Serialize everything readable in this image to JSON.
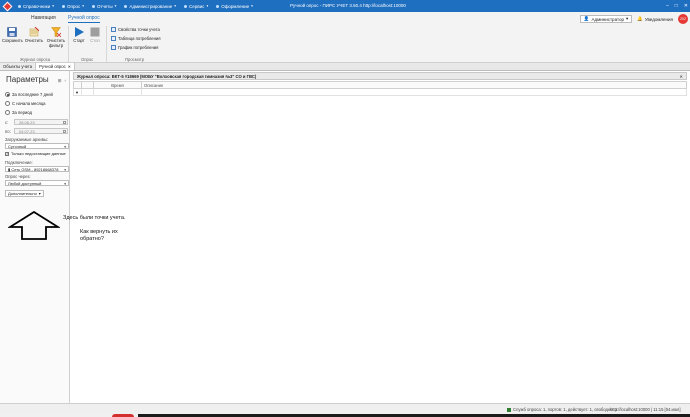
{
  "titlebar": {
    "menu": [
      {
        "label": "Справочники"
      },
      {
        "label": "Опрос"
      },
      {
        "label": "Отчеты"
      },
      {
        "label": "Администрирование"
      },
      {
        "label": "Сервис"
      },
      {
        "label": "Оформление"
      }
    ],
    "title": "Ручной опрос - ПИРС УЧЕТ 3.50.4 http://localhost:10000"
  },
  "ribbon": {
    "tabs": {
      "nav": "Навигация",
      "manual": "Ручной опрос"
    },
    "buttons": {
      "save": "Сохранить",
      "clear": "Очистить",
      "clear_filter_1": "Очистить",
      "clear_filter_2": "фильтр",
      "start": "Старт",
      "stop": "Стоп"
    },
    "links": {
      "properties": "Свойства точки учета",
      "table": "Таблица потребления",
      "chart": "График потребления"
    },
    "groups": {
      "journal": "Журнал опроса",
      "poll": "Опрос",
      "view": "Просмотр"
    }
  },
  "user": {
    "name": "Администратор",
    "notifications": "Уведомления",
    "avatar": "202"
  },
  "doc_tabs": [
    {
      "label": "Объекты учета"
    },
    {
      "label": "Ручной опрос"
    }
  ],
  "params": {
    "title": "Параметры",
    "period_options": [
      "За последние 7 дней",
      "С начала месяца",
      "За период"
    ],
    "from_label": "с:",
    "from_value": "28.06.23",
    "to_label": "по:",
    "to_value": "04.07.23",
    "archives_label": "Загружаемые архивы:",
    "archives_value": "Суточный",
    "missing_only": "Только недостающие данные",
    "connection_label": "Подключение:",
    "connection_value": "Сеть GSM - 89218668378",
    "poll_via_label": "Опрос через:",
    "poll_via_value": "Любой доступный",
    "extra": "Дополнительно"
  },
  "journal": {
    "header": "Журнал опроса: ВКТ-5 #18669 (МОБУ \"Волховская городская гимназия №3\" СО и ГВС)",
    "columns": [
      "Время",
      "Описание"
    ]
  },
  "annotation": {
    "line1": "Здесь были точки учета.",
    "line2": "Как вернуть их обратно?"
  },
  "status": {
    "stats": "Служб опроса: 1, портов: 1, действует: 1, свободно: 1",
    "url": "http://localhost:10000 | 11:15 [04.июл]"
  },
  "colors": {
    "accent": "#1f6fc0",
    "brand": "#e53935"
  }
}
